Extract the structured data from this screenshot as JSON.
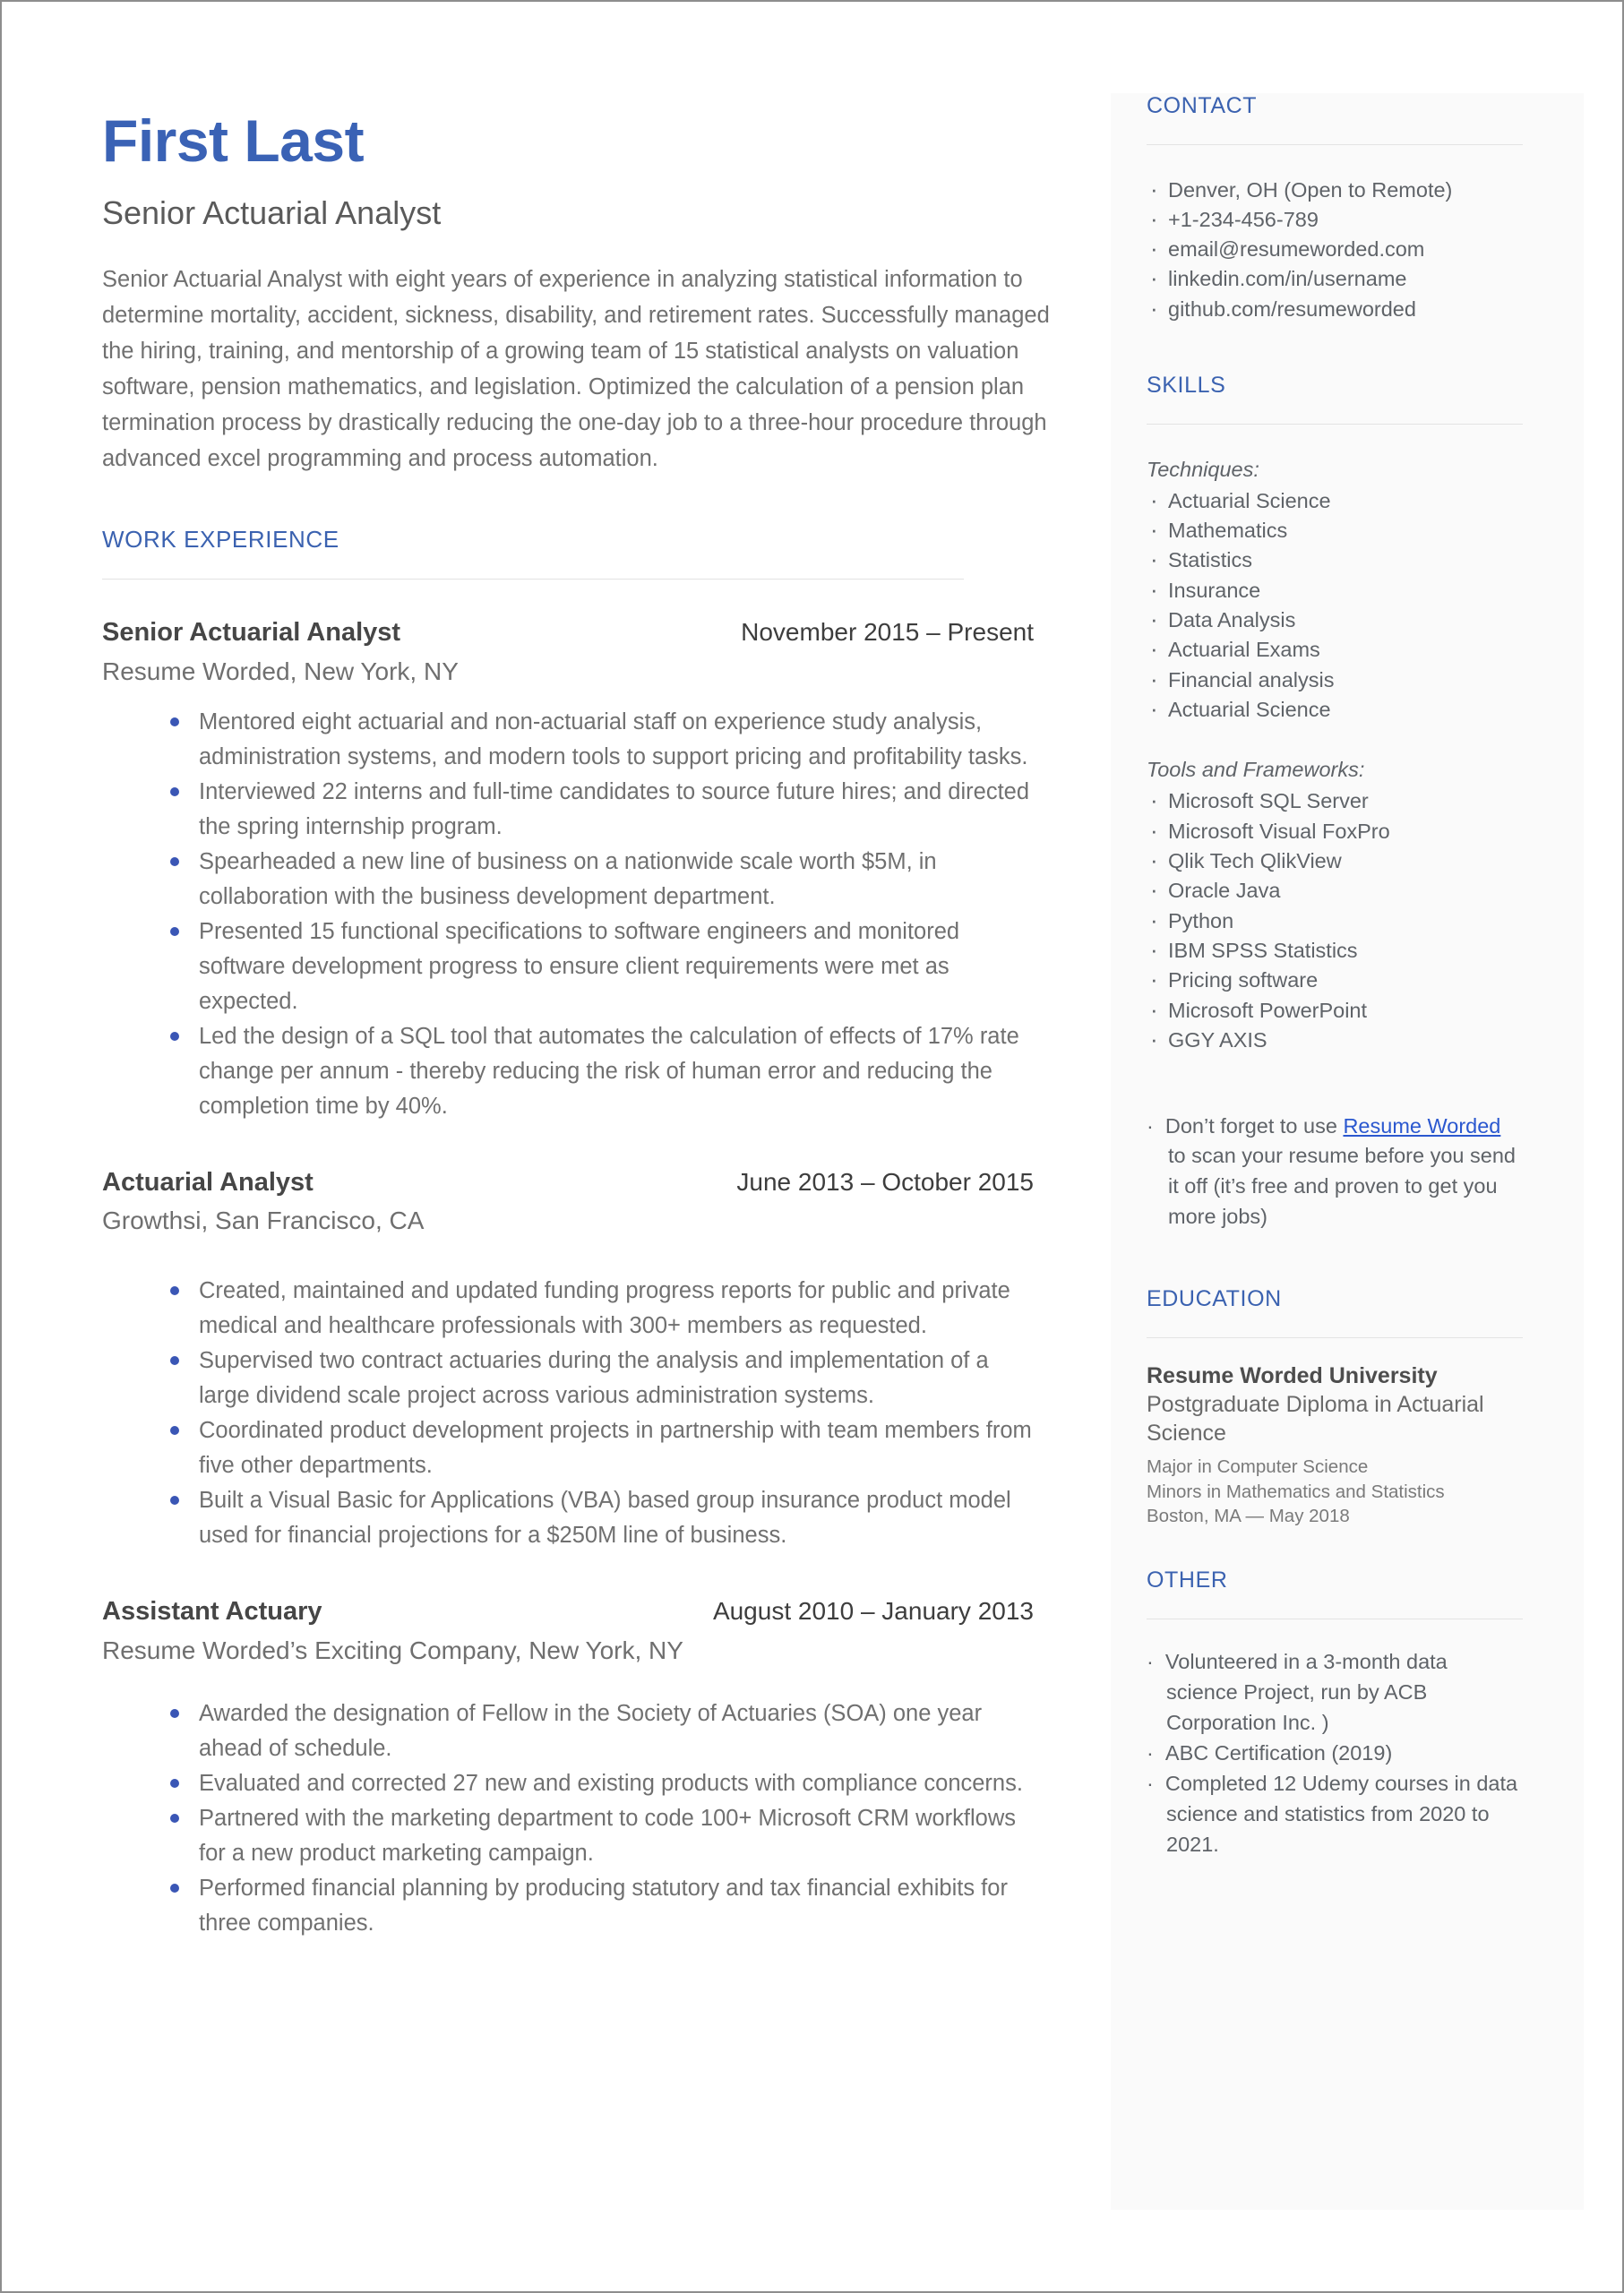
{
  "document_type": "resume",
  "colors": {
    "accent_blue": "#3b62b0",
    "name_blue": "#3a62b5",
    "bullet_blue": "#3a56b5",
    "body_gray": "#707070",
    "sidebar_bg": "#fafafa",
    "rule_gray": "#e3e3e3",
    "link_blue": "#2b58cf"
  },
  "header": {
    "name": "First Last",
    "headline": "Senior Actuarial Analyst",
    "summary": "Senior Actuarial Analyst with eight years of experience in analyzing statistical information to determine mortality, accident, sickness, disability, and retirement rates. Successfully managed the hiring, training, and mentorship of a growing team of 15 statistical analysts on valuation software, pension mathematics, and legislation. Optimized the calculation of a pension plan termination process by drastically reducing the one-day job to a three-hour procedure through advanced excel programming and process automation."
  },
  "work_experience": {
    "heading": "WORK EXPERIENCE",
    "jobs": [
      {
        "title": "Senior Actuarial Analyst",
        "dates": "November 2015 – Present",
        "company": "Resume Worded, New York, NY",
        "bullets": [
          "Mentored eight actuarial and non-actuarial staff on experience study analysis, administration systems, and modern tools to support pricing and profitability tasks.",
          "Interviewed 22 interns and full-time candidates to source future hires; and directed the spring internship program.",
          "Spearheaded a new line of business on a nationwide scale worth $5M, in collaboration with the business development department.",
          "Presented 15 functional specifications to software engineers and monitored software development progress to ensure client requirements were met as expected.",
          "Led the design of a SQL tool that automates the calculation of effects of 17% rate change per annum - thereby reducing the risk of human error and reducing the completion time by 40%."
        ]
      },
      {
        "title": "Actuarial Analyst",
        "dates": "June 2013 – October 2015",
        "company": "Growthsi, San Francisco, CA",
        "bullets": [
          "Created, maintained and updated funding progress reports for public and private medical and healthcare professionals with 300+ members as requested.",
          "Supervised two contract actuaries during the analysis and implementation of a large dividend scale project across various administration systems.",
          "Coordinated product development projects in partnership with team members from five other departments.",
          "Built a Visual Basic for Applications (VBA) based group insurance product model used for financial projections for a $250M line of business."
        ]
      },
      {
        "title": "Assistant Actuary",
        "dates": "August 2010 – January 2013",
        "company": "Resume Worded’s Exciting Company, New York, NY",
        "bullets": [
          "Awarded the designation of Fellow in the Society of Actuaries (SOA) one year ahead of schedule.",
          "Evaluated and corrected 27 new and existing products with compliance concerns.",
          "Partnered with the marketing department to code 100+ Microsoft CRM workflows for a new product marketing campaign.",
          "Performed financial planning by producing statutory and tax financial exhibits for three companies."
        ]
      }
    ]
  },
  "sidebar": {
    "contact": {
      "heading": "CONTACT",
      "items": [
        " Denver, OH (Open to Remote)",
        "+1-234-456-789",
        "email@resumeworded.com",
        "linkedin.com/in/username",
        "github.com/resumeworded"
      ]
    },
    "skills": {
      "heading": "SKILLS",
      "groups": [
        {
          "label": "Techniques:",
          "items": [
            "Actuarial Science",
            "Mathematics",
            "Statistics",
            "Insurance",
            "Data Analysis",
            "Actuarial Exams",
            "Financial analysis",
            "Actuarial Science"
          ]
        },
        {
          "label": "Tools and Frameworks:",
          "items": [
            "Microsoft SQL Server",
            "Microsoft Visual FoxPro",
            "Qlik Tech QlikView",
            "Oracle Java",
            "Python",
            "IBM SPSS Statistics",
            "Pricing software",
            "Microsoft PowerPoint",
            "GGY AXIS"
          ]
        }
      ],
      "promo": {
        "before": "Don’t forget to use ",
        "link": "Resume Worded",
        "after": " to scan your resume before you send it off (it’s free and proven to get you more jobs)"
      }
    },
    "education": {
      "heading": "EDUCATION",
      "school": "Resume Worded University",
      "degree": "Postgraduate Diploma in Actuarial Science",
      "details": [
        "Major in Computer Science",
        "Minors in Mathematics and Statistics",
        "Boston, MA — May 2018"
      ]
    },
    "other": {
      "heading": "OTHER",
      "items": [
        "Volunteered in a 3-month data science Project, run by ACB Corporation Inc. )",
        "ABC Certification (2019)",
        "Completed 12 Udemy courses in data science and statistics from 2020 to 2021."
      ]
    }
  }
}
